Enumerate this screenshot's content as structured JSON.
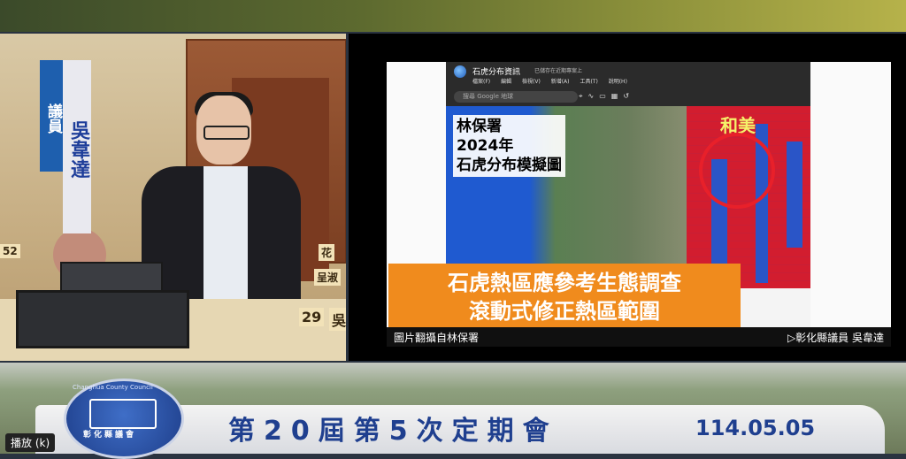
{
  "councilor": {
    "title_chars": "議員",
    "name_chars": "吳韋達"
  },
  "desk_tags": [
    "52",
    "花",
    "呈淑",
    "29",
    "吳"
  ],
  "window": {
    "title": "石虎分布資訊",
    "subtitle": "已儲存在近期專案上",
    "menu": [
      "檔案(F)",
      "編輯",
      "檢視(V)",
      "新增(A)",
      "工具(T)",
      "說明(H)"
    ],
    "search_placeholder": "搜尋 Google 地球"
  },
  "map": {
    "label_lines": [
      "林保署",
      "2024年",
      "石虎分布模擬圖"
    ],
    "place_label": "和美"
  },
  "orange_box": {
    "line1": "石虎熱區應參考生態調查",
    "line2": "滾動式修正熱區範圍"
  },
  "caption": {
    "left": "圖片翻攝自林保署",
    "right": "▷彰化縣議員 吳韋達"
  },
  "banner": {
    "title": "第20屆第5次定期會",
    "date": "114.05.05"
  },
  "logo": {
    "ring_text": "Changhua County Council",
    "name": "彰化縣議會"
  },
  "player": {
    "play_label": "播放 (k)"
  }
}
